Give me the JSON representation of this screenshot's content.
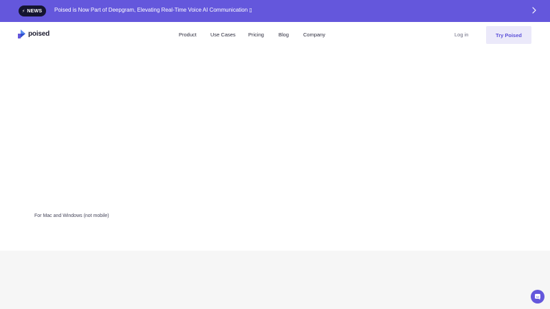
{
  "announcement": {
    "badge_label": "NEWS",
    "badge_icon": "lightning-icon",
    "message": "Poised is Now Part of Deepgram, Elevating Real-Time Voice AI Communication",
    "trailing_glyph": "▯",
    "chevron_icon": "chevron-right-icon"
  },
  "header": {
    "brand_name": "poised",
    "nav_items": [
      {
        "label": "Product"
      },
      {
        "label": "Use Cases"
      },
      {
        "label": "Pricing"
      },
      {
        "label": "Blog"
      },
      {
        "label": "Company"
      }
    ],
    "login_label": "Log in",
    "cta_label": "Try Poised"
  },
  "hero": {
    "platform_note": "For Mac and Windows (not mobile)"
  },
  "colors": {
    "accent": "#6457dc",
    "cta_background": "#ebe9fa",
    "cta_text": "#5b4fd8",
    "badge_background": "#151530",
    "section_gray": "#f6f6f6"
  },
  "chat_widget": {
    "icon": "chat-bubble-icon"
  }
}
